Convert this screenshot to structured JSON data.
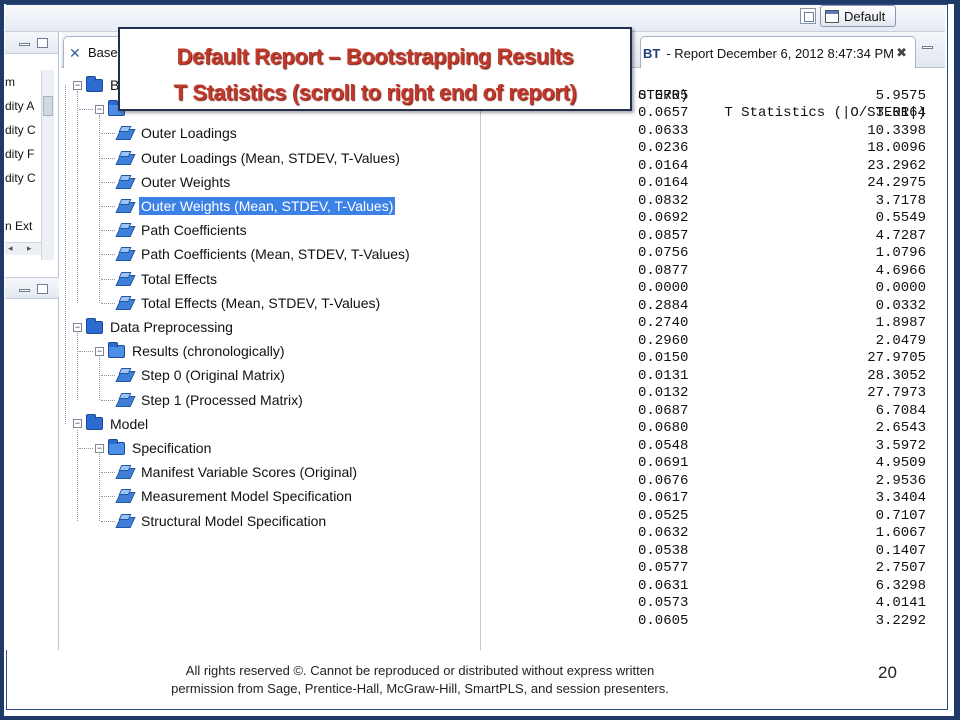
{
  "top_bar": {
    "perspective_label": "Default"
  },
  "left_pane": {
    "items": [
      "m",
      "dity A",
      "dity C",
      "dity F",
      "dity C",
      "",
      "n Ext"
    ]
  },
  "navigator": {
    "tab_label": "Base M",
    "tree": [
      {
        "label": "B",
        "kind": "folder",
        "level": 0
      },
      {
        "label": "",
        "kind": "folder",
        "level": 1
      },
      {
        "label": "Outer Loadings",
        "kind": "report",
        "level": 2
      },
      {
        "label": "Outer Loadings (Mean, STDEV, T-Values)",
        "kind": "report",
        "level": 2
      },
      {
        "label": "Outer Weights",
        "kind": "report",
        "level": 2
      },
      {
        "label": "Outer Weights (Mean, STDEV, T-Values)",
        "kind": "report",
        "level": 2,
        "selected": true
      },
      {
        "label": "Path Coefficients",
        "kind": "report",
        "level": 2
      },
      {
        "label": "Path Coefficients (Mean, STDEV, T-Values)",
        "kind": "report",
        "level": 2
      },
      {
        "label": "Total Effects",
        "kind": "report",
        "level": 2
      },
      {
        "label": "Total Effects (Mean, STDEV, T-Values)",
        "kind": "report",
        "level": 2
      },
      {
        "label": "Data Preprocessing",
        "kind": "folder",
        "level": 0
      },
      {
        "label": "Results (chronologically)",
        "kind": "folder",
        "level": 1
      },
      {
        "label": "Step 0 (Original Matrix)",
        "kind": "report",
        "level": 2
      },
      {
        "label": "Step 1 (Processed Matrix)",
        "kind": "report",
        "level": 2
      },
      {
        "label": "Model",
        "kind": "folder",
        "level": 0
      },
      {
        "label": "Specification",
        "kind": "folder",
        "level": 1
      },
      {
        "label": "Manifest Variable Scores (Original)",
        "kind": "report",
        "level": 2
      },
      {
        "label": "Measurement Model Specification",
        "kind": "report",
        "level": 2
      },
      {
        "label": "Structural Model Specification",
        "kind": "report",
        "level": 2
      }
    ]
  },
  "report": {
    "tab_prefix": "BT",
    "tab_title": "- Report December 6, 2012 8:47:34 PM",
    "col_sterr_header": "STERR)",
    "col_t_header": "T Statistics (|O/STERR|)",
    "rows": [
      [
        "0.0705",
        "5.9575"
      ],
      [
        "0.0657",
        "3.0164"
      ],
      [
        "0.0633",
        "10.3398"
      ],
      [
        "0.0236",
        "18.0096"
      ],
      [
        "0.0164",
        "23.2962"
      ],
      [
        "0.0164",
        "24.2975"
      ],
      [
        "0.0832",
        "3.7178"
      ],
      [
        "0.0692",
        "0.5549"
      ],
      [
        "0.0857",
        "4.7287"
      ],
      [
        "0.0756",
        "1.0796"
      ],
      [
        "0.0877",
        "4.6966"
      ],
      [
        "0.0000",
        "0.0000"
      ],
      [
        "0.2884",
        "0.0332"
      ],
      [
        "0.2740",
        "1.8987"
      ],
      [
        "0.2960",
        "2.0479"
      ],
      [
        "0.0150",
        "27.9705"
      ],
      [
        "0.0131",
        "28.3052"
      ],
      [
        "0.0132",
        "27.7973"
      ],
      [
        "0.0687",
        "6.7084"
      ],
      [
        "0.0680",
        "2.6543"
      ],
      [
        "0.0548",
        "3.5972"
      ],
      [
        "0.0691",
        "4.9509"
      ],
      [
        "0.0676",
        "2.9536"
      ],
      [
        "0.0617",
        "3.3404"
      ],
      [
        "0.0525",
        "0.7107"
      ],
      [
        "0.0632",
        "1.6067"
      ],
      [
        "0.0538",
        "0.1407"
      ],
      [
        "0.0577",
        "2.7507"
      ],
      [
        "0.0631",
        "6.3298"
      ],
      [
        "0.0573",
        "4.0141"
      ],
      [
        "0.0605",
        "3.2292"
      ]
    ]
  },
  "callout": {
    "line1": "Default Report – Bootstrapping Results",
    "line2": "T Statistics (scroll to right end of report)"
  },
  "footer": {
    "copyright_line1": "All rights reserved ©.    Cannot be reproduced or distributed without express written",
    "copyright_line2": "permission from Sage, Prentice-Hall, McGraw-Hill, SmartPLS, and session presenters.",
    "page_number": "20"
  },
  "colors": {
    "frame": "#1f3a68",
    "title_red": "#c0392b",
    "selection_blue": "#3c82e6"
  }
}
